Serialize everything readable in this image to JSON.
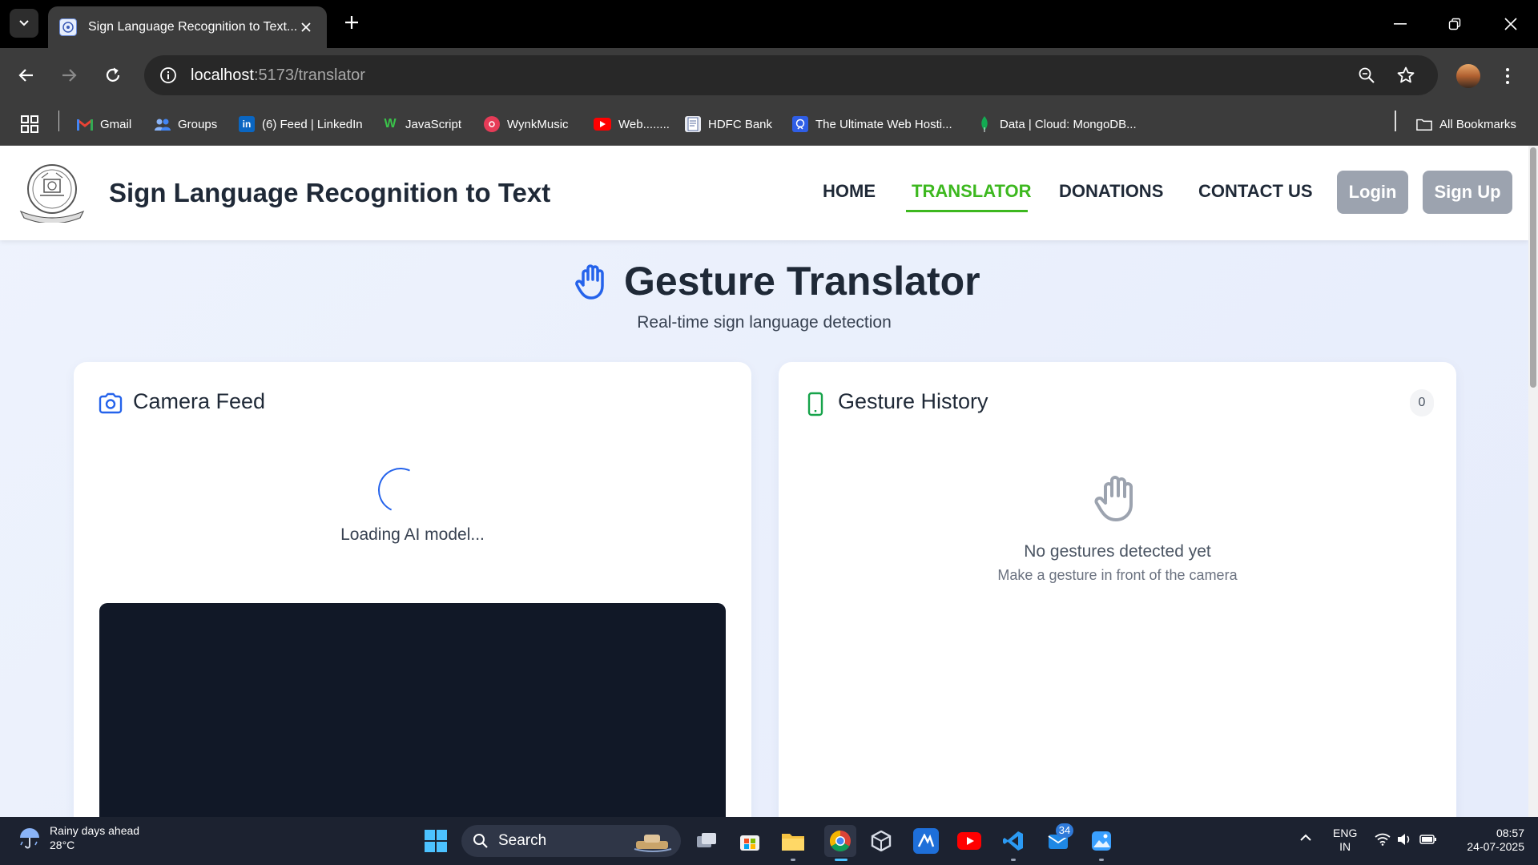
{
  "browser": {
    "tab_title": "Sign Language Recognition to Text...",
    "url_host": "localhost",
    "url_path": ":5173/translator",
    "bookmarks": [
      {
        "label": "Gmail"
      },
      {
        "label": "Groups"
      },
      {
        "label": "(6) Feed | LinkedIn"
      },
      {
        "label": "JavaScript"
      },
      {
        "label": "WynkMusic"
      },
      {
        "label": "Web........"
      },
      {
        "label": "HDFC Bank"
      },
      {
        "label": "The Ultimate Web Hosti..."
      },
      {
        "label": "Data | Cloud: MongoDB..."
      }
    ],
    "all_bookmarks": "All Bookmarks"
  },
  "site": {
    "title": "Sign Language Recognition to Text",
    "nav": [
      {
        "label": "HOME",
        "active": false
      },
      {
        "label": "TRANSLATOR",
        "active": true
      },
      {
        "label": "DONATIONS",
        "active": false
      },
      {
        "label": "CONTACT US",
        "active": false
      }
    ],
    "login_label": "Login",
    "signup_label": "Sign Up"
  },
  "hero": {
    "title": "Gesture Translator",
    "subtitle": "Real-time sign language detection"
  },
  "camera": {
    "title": "Camera Feed",
    "loading_text": "Loading AI model..."
  },
  "history": {
    "title": "Gesture History",
    "count": "0",
    "empty_title": "No gestures detected yet",
    "empty_sub": "Make a gesture in front of the camera"
  },
  "taskbar": {
    "weather_title": "Rainy days ahead",
    "weather_temp": "28°C",
    "search_label": "Search",
    "notification_count": "34",
    "lang_1": "ENG",
    "lang_2": "IN",
    "time": "08:57",
    "date": "24-07-2025"
  },
  "colors": {
    "accent_green": "#3db81f",
    "accent_blue": "#2563eb",
    "text_dark": "#1f2937",
    "button_gray": "#9ca3af"
  }
}
